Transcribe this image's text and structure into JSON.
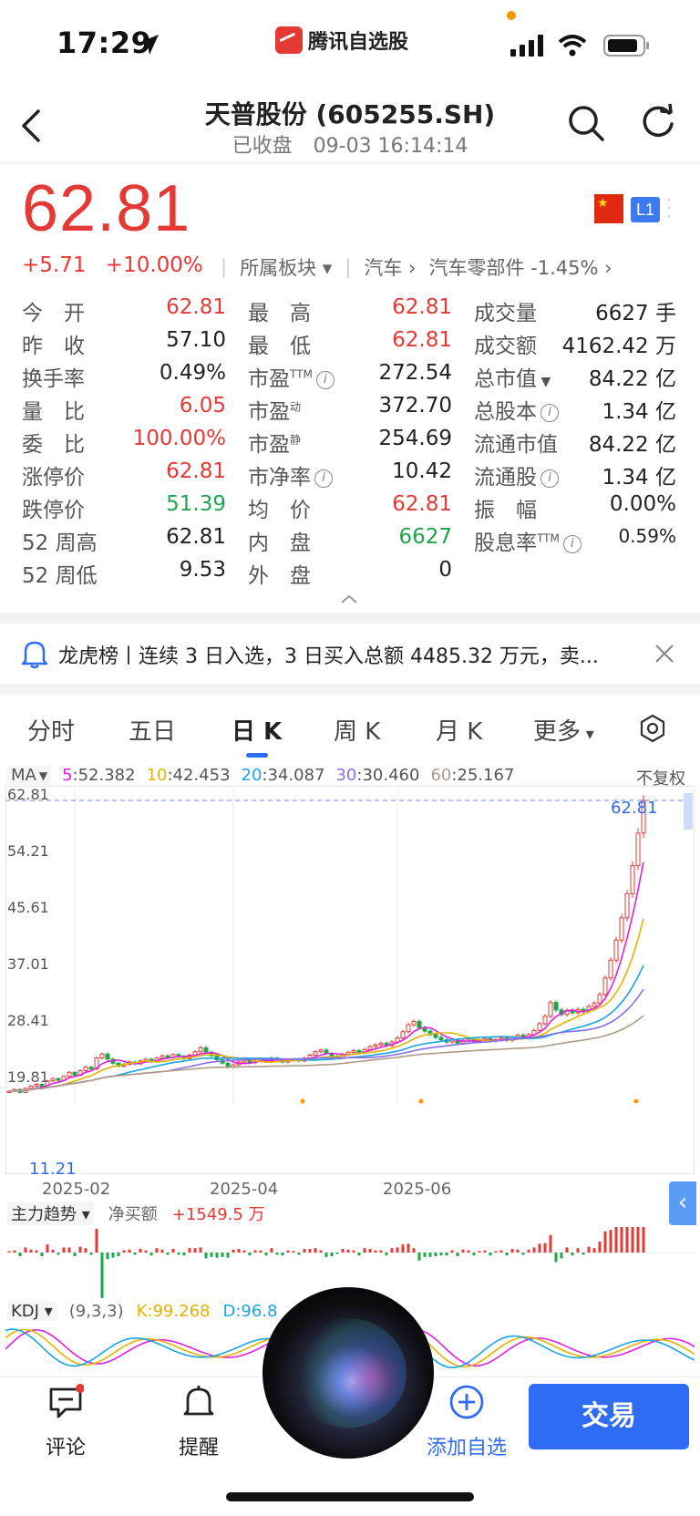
{
  "status_bar": {
    "time": "17:29",
    "app_name": "腾讯自选股"
  },
  "header": {
    "title": "天普股份 (605255.SH)",
    "status": "已收盘",
    "datetime": "09-03 16:14:14"
  },
  "price": {
    "last": "62.81",
    "change": "+5.71",
    "change_pct": "+10.00%",
    "sector_label": "所属板块",
    "sector1": "汽车",
    "sector2": "汽车零部件 -1.45%",
    "l1_badge": "L1"
  },
  "quote": {
    "col1": [
      {
        "label": "今　开",
        "value": "62.81",
        "color": "red"
      },
      {
        "label": "昨　收",
        "value": "57.10",
        "color": "dark"
      },
      {
        "label": "换手率",
        "value": "0.49%",
        "color": "dark"
      },
      {
        "label": "量　比",
        "value": "6.05",
        "color": "red"
      },
      {
        "label": "委　比",
        "value": "100.00%",
        "color": "red"
      },
      {
        "label": "涨停价",
        "value": "62.81",
        "color": "red"
      },
      {
        "label": "跌停价",
        "value": "51.39",
        "color": "green"
      },
      {
        "label": "52 周高",
        "value": "62.81",
        "color": "dark"
      },
      {
        "label": "52 周低",
        "value": "9.53",
        "color": "dark"
      }
    ],
    "col2": [
      {
        "label": "最　高",
        "value": "62.81",
        "color": "red"
      },
      {
        "label": "最　低",
        "value": "62.81",
        "color": "red"
      },
      {
        "label": "市盈",
        "sup": "TTM",
        "info": true,
        "value": "272.54",
        "color": "dark"
      },
      {
        "label": "市盈",
        "sup": "动",
        "value": "372.70",
        "color": "dark"
      },
      {
        "label": "市盈",
        "sup": "静",
        "value": "254.69",
        "color": "dark"
      },
      {
        "label": "市净率",
        "info": true,
        "value": "10.42",
        "color": "dark"
      },
      {
        "label": "均　价",
        "value": "62.81",
        "color": "red"
      },
      {
        "label": "内　盘",
        "value": "6627",
        "color": "green"
      },
      {
        "label": "外　盘",
        "value": "0",
        "color": "dark"
      }
    ],
    "col3": [
      {
        "label": "成交量",
        "value": "6627 手",
        "color": "dark"
      },
      {
        "label": "成交额",
        "value": "4162.42 万",
        "color": "dark"
      },
      {
        "label": "总市值",
        "dropdown": true,
        "value": "84.22 亿",
        "color": "dark"
      },
      {
        "label": "总股本",
        "info": true,
        "value": "1.34 亿",
        "color": "dark"
      },
      {
        "label": "流通市值",
        "value": "84.22 亿",
        "color": "dark"
      },
      {
        "label": "流通股",
        "info": true,
        "value": "1.34 亿",
        "color": "dark"
      },
      {
        "label": "振　幅",
        "value": "0.00%",
        "color": "dark"
      },
      {
        "label": "股息率",
        "sup": "TTM",
        "info": true,
        "value": "0.59%",
        "color": "dark"
      }
    ]
  },
  "notice": {
    "text": "龙虎榜丨连续 3 日入选，3 日买入总额 4485.32 万元，卖..."
  },
  "tabs": [
    "分时",
    "五日",
    "日 K",
    "周 K",
    "月 K",
    "更多"
  ],
  "active_tab": "日 K",
  "ma": {
    "label": "MA",
    "items": [
      {
        "key": "5",
        "value": ":52.382",
        "color": "#e020e0"
      },
      {
        "key": "10",
        "value": ":42.453",
        "color": "#e0b400"
      },
      {
        "key": "20",
        "value": ":34.087",
        "color": "#1aa5e0"
      },
      {
        "key": "30",
        "value": ":30.460",
        "color": "#8a6ee8"
      },
      {
        "key": "60",
        "value": ":25.167",
        "color": "#b09a88"
      }
    ],
    "adjust": "不复权"
  },
  "chart_data": {
    "type": "candlestick",
    "y_ticks": [
      "62.81",
      "54.21",
      "45.61",
      "37.01",
      "28.41",
      "19.81",
      "11.21"
    ],
    "x_ticks": [
      "2025-02",
      "2025-04",
      "2025-06"
    ],
    "last_price_marker": "62.81",
    "ylim": [
      11.21,
      62.81
    ],
    "close_series": [
      12,
      12.3,
      11.8,
      12.5,
      12.9,
      13.2,
      12.7,
      13.8,
      14.2,
      13.9,
      14.6,
      15.3,
      14.8,
      15.6,
      16.2,
      15.9,
      17.8,
      18.5,
      17.6,
      16.9,
      16.4,
      16.7,
      17.1,
      16.8,
      17.3,
      17.6,
      17.2,
      17.8,
      18.2,
      17.9,
      18.4,
      18.1,
      17.7,
      18.3,
      18.9,
      19.6,
      18.8,
      18.2,
      17.5,
      16.9,
      16.2,
      16.6,
      17.1,
      17.4,
      17.0,
      17.3,
      17.6,
      17.2,
      17.8,
      17.5,
      17.1,
      17.4,
      17.6,
      17.3,
      17.8,
      18.3,
      18.9,
      19.2,
      18.6,
      18.1,
      17.9,
      18.4,
      18.8,
      19.1,
      18.7,
      19.3,
      19.8,
      20.1,
      20.4,
      20.0,
      20.6,
      21.3,
      22.4,
      23.6,
      24.2,
      23.1,
      22.5,
      21.9,
      21.4,
      21.0,
      20.6,
      20.9,
      20.4,
      20.8,
      21.1,
      20.7,
      20.9,
      21.2,
      20.8,
      21.0,
      21.3,
      20.9,
      21.4,
      21.8,
      21.5,
      21.9,
      22.6,
      23.8,
      25.1,
      27.5,
      26.2,
      25.4,
      26.1,
      25.7,
      26.3,
      26.0,
      26.8,
      27.4,
      28.9,
      31.8,
      34.9,
      38.4,
      42.3,
      46.5,
      51.4,
      57.1,
      62.8
    ],
    "money_flow": {
      "label": "净买额",
      "value": "+1549.5 万"
    },
    "kdj": {
      "params": "(9,3,3)",
      "K": "99.268",
      "D": "96.8"
    }
  },
  "flow_title": "主力趋势",
  "kdj_title": "KDJ",
  "bottom": {
    "comment": "评论",
    "alert": "提醒",
    "add": "添加自选",
    "trade": "交易"
  }
}
